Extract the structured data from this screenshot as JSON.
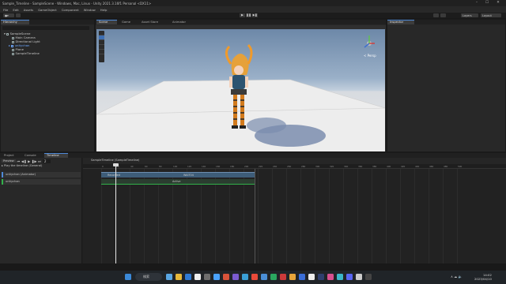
{
  "window": {
    "title": "Sample_Timeline - SampleScene - Windows, Mac, Linux - Unity 2021.3.16f1 Personal <DX11>"
  },
  "menu": [
    "File",
    "Edit",
    "Assets",
    "GameObject",
    "Component",
    "Window",
    "Help"
  ],
  "toolbar": {
    "layers_label": "Layers",
    "layout_label": "Layout"
  },
  "hierarchy": {
    "tab_label": "Hierarchy",
    "items": [
      "SampleScene",
      "Main Camera",
      "Directional Light",
      "unitychan",
      "Plane",
      "SampleTimeline"
    ]
  },
  "center_tabs": [
    "Scene",
    "Game",
    "Asset Store",
    "Animator"
  ],
  "inspector": {
    "tab_label": "Inspector"
  },
  "scene": {
    "persp_label": "< Persp"
  },
  "bottom_tabs": [
    "Project",
    "Console",
    "Timeline"
  ],
  "timeline": {
    "preview_label": "Preview",
    "frame_value": "2",
    "play_on_awake_label": "Play the timeline (General)",
    "asset_path": "SampleTimeline (SampleTimeline)",
    "track_animation_label": "unitychan (Animator)",
    "track_activation_label": "unitychan",
    "clip1_label": "Recorded",
    "clip2_label": "WAIT04",
    "active_clip_label": "Active",
    "ticks": [
      "0",
      "20",
      "40",
      "60",
      "80",
      "100",
      "120",
      "140",
      "160",
      "180",
      "200",
      "220",
      "240",
      "260",
      "280",
      "300",
      "320",
      "340",
      "360",
      "380",
      "400",
      "420",
      "440",
      "460",
      "480",
      "500"
    ]
  },
  "taskbar": {
    "search_label": "検索",
    "time": "14:02",
    "date": "2023/04/10"
  },
  "colors": {
    "accent": "#4f8ad8",
    "activation_track": "#32b14a",
    "clip_blue": "#3e5d79"
  }
}
